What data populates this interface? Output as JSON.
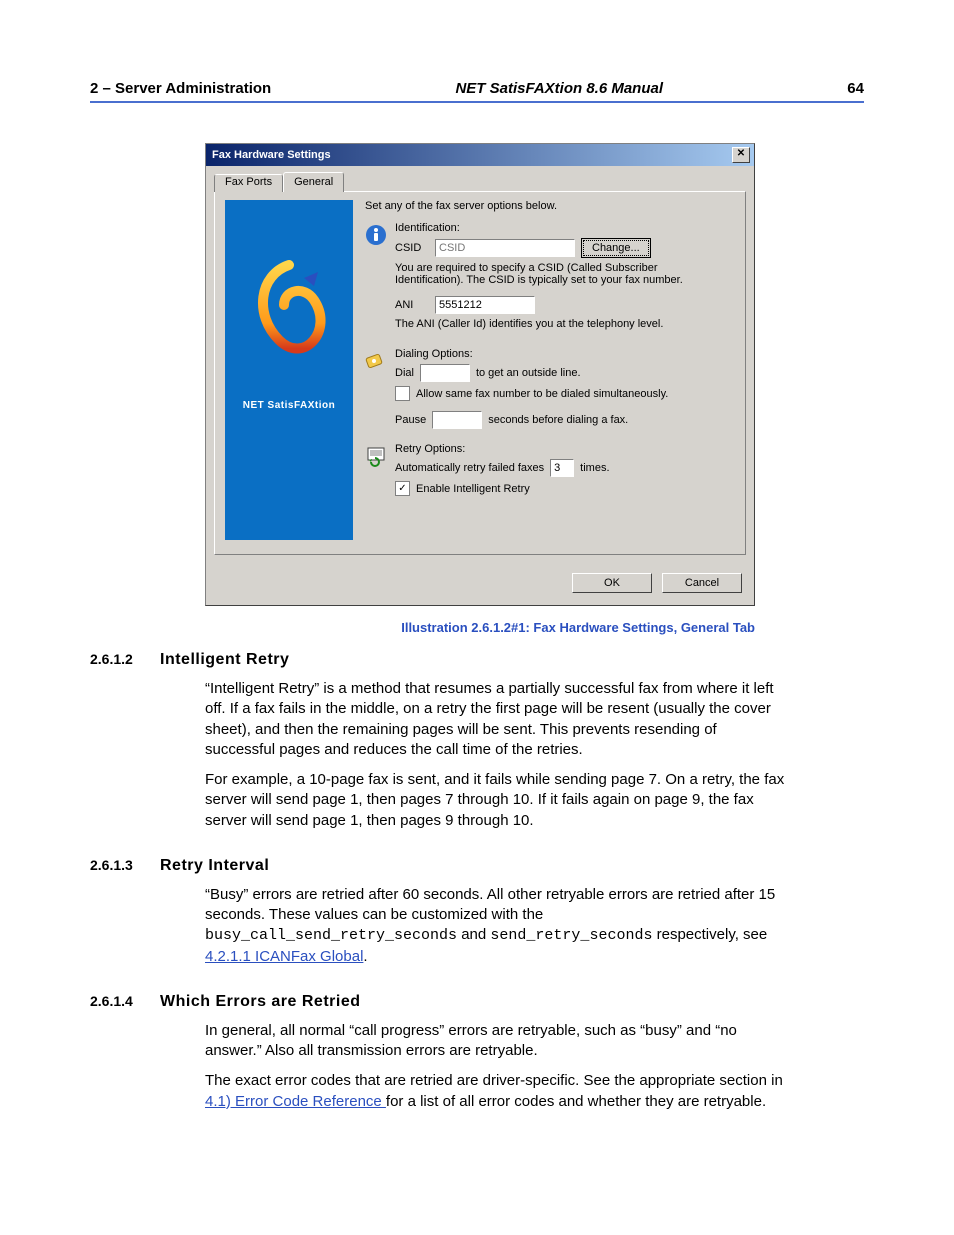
{
  "header": {
    "left_chapter": "2",
    "left_dash": " – ",
    "left_title": "Server Administration",
    "center": "NET SatisFAXtion 8.6 Manual",
    "page_number": "64"
  },
  "dialog": {
    "title": "Fax Hardware Settings",
    "close": "✕",
    "tabs": {
      "faxports": "Fax Ports",
      "general": "General"
    },
    "top_text": "Set any of the fax server options below.",
    "side_brand": "NET SatisFAXtion",
    "ident": {
      "heading": "Identification:",
      "csid_label": "CSID",
      "csid_placeholder": "CSID",
      "change_btn": "Change...",
      "csid_help": "You are required to specify a CSID (Called Subscriber Identification). The CSID is typically set to your fax number.",
      "ani_label": "ANI",
      "ani_value": "5551212",
      "ani_help": "The ANI (Caller Id) identifies you at the telephony level."
    },
    "dialing": {
      "heading": "Dialing Options:",
      "dial_label": "Dial",
      "dial_value": "",
      "dial_after": "to get an outside line.",
      "allow_same": "Allow same fax number to be dialed simultaneously.",
      "pause_label": "Pause",
      "pause_value": "",
      "pause_after": "seconds before dialing a fax."
    },
    "retry": {
      "heading": "Retry Options:",
      "auto_label": "Automatically retry failed faxes",
      "auto_value": "3",
      "auto_after": "times.",
      "enable_intel": "Enable Intelligent Retry"
    },
    "buttons": {
      "ok": "OK",
      "cancel": "Cancel"
    }
  },
  "caption": "Illustration 2.6.1.2#1: Fax Hardware Settings, General Tab",
  "sec1": {
    "num": "2.6.1.2",
    "title": "Intelligent Retry",
    "p1": "“Intelligent Retry” is a method that resumes a partially successful fax from where it left off. If a fax fails in the middle, on a retry the first page will be resent (usually the cover sheet), and then the remaining pages will be sent. This prevents resending of successful pages and reduces the call time of the retries.",
    "p2": "For example, a 10-page fax is sent, and it fails while sending page 7. On a retry, the fax server will send page 1, then pages 7 through 10. If it fails again on page 9, the fax server will send page 1, then pages 9 through 10."
  },
  "sec2": {
    "num": "2.6.1.3",
    "title": "Retry Interval",
    "p1_a": "“Busy” errors are retried after 60 seconds. All other retryable errors are retried after 15 seconds. These values can be customized with the ",
    "code1": "busy_call_send_retry_seconds",
    "mid": " and ",
    "code2": "send_retry_seconds",
    "p1_b": " respectively, see ",
    "link": "4.2.1.1 ICANFax Global",
    "tail": "."
  },
  "sec3": {
    "num": "2.6.1.4",
    "title": "Which Errors are Retried",
    "p1": "In general, all normal “call progress” errors are retryable, such as “busy” and “no answer.” Also all transmission errors are retryable.",
    "p2_a": "The exact error codes that are retried are driver-specific. See the appropriate section in ",
    "link": "4.1) Error Code Reference ",
    "p2_b": "for a list of all error codes and whether they are retryable."
  }
}
